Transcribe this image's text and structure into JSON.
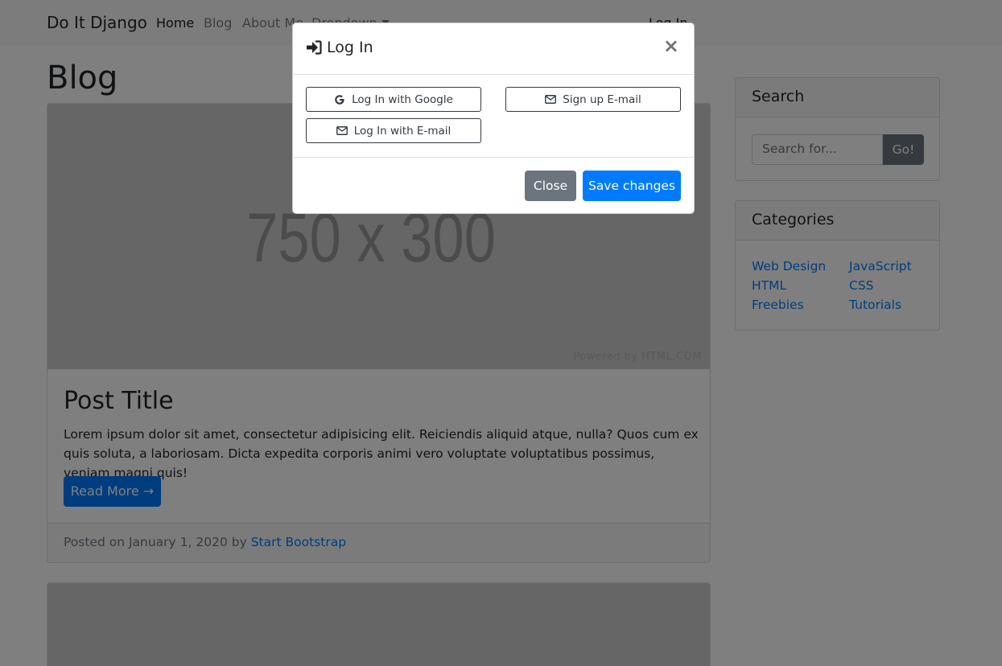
{
  "navbar": {
    "brand": "Do It Django",
    "links": [
      "Home",
      "Blog",
      "About Me",
      "Dropdown"
    ],
    "login": "Log In"
  },
  "main": {
    "title": "Blog",
    "post": {
      "image_text": "750 x 300",
      "image_credit": "Powered by HTML.COM",
      "title": "Post Title",
      "body": "Lorem ipsum dolor sit amet, consectetur adipisicing elit. Reiciendis aliquid atque, nulla? Quos cum ex quis soluta, a laboriosam. Dicta expedita corporis animi vero voluptate voluptatibus possimus, veniam magni quis!",
      "read_more": "Read More →",
      "footer_prefix": "Posted on January 1, 2020 by",
      "author": "Start Bootstrap"
    }
  },
  "sidebar": {
    "search": {
      "title": "Search",
      "placeholder": "Search for...",
      "button": "Go!"
    },
    "categories": {
      "title": "Categories",
      "items": [
        "Web Design",
        "JavaScript",
        "HTML",
        "CSS",
        "Freebies",
        "Tutorials"
      ]
    }
  },
  "modal": {
    "title": "Log In",
    "buttons": {
      "google": "Log In with Google",
      "signup": "Sign up E-mail",
      "email_login": "Log In with E-mail"
    },
    "close": "Close",
    "save": "Save changes",
    "close_symbol": "×"
  },
  "colors": {
    "primary": "#007bff",
    "secondary": "#6c757d",
    "dark": "#343a40"
  }
}
